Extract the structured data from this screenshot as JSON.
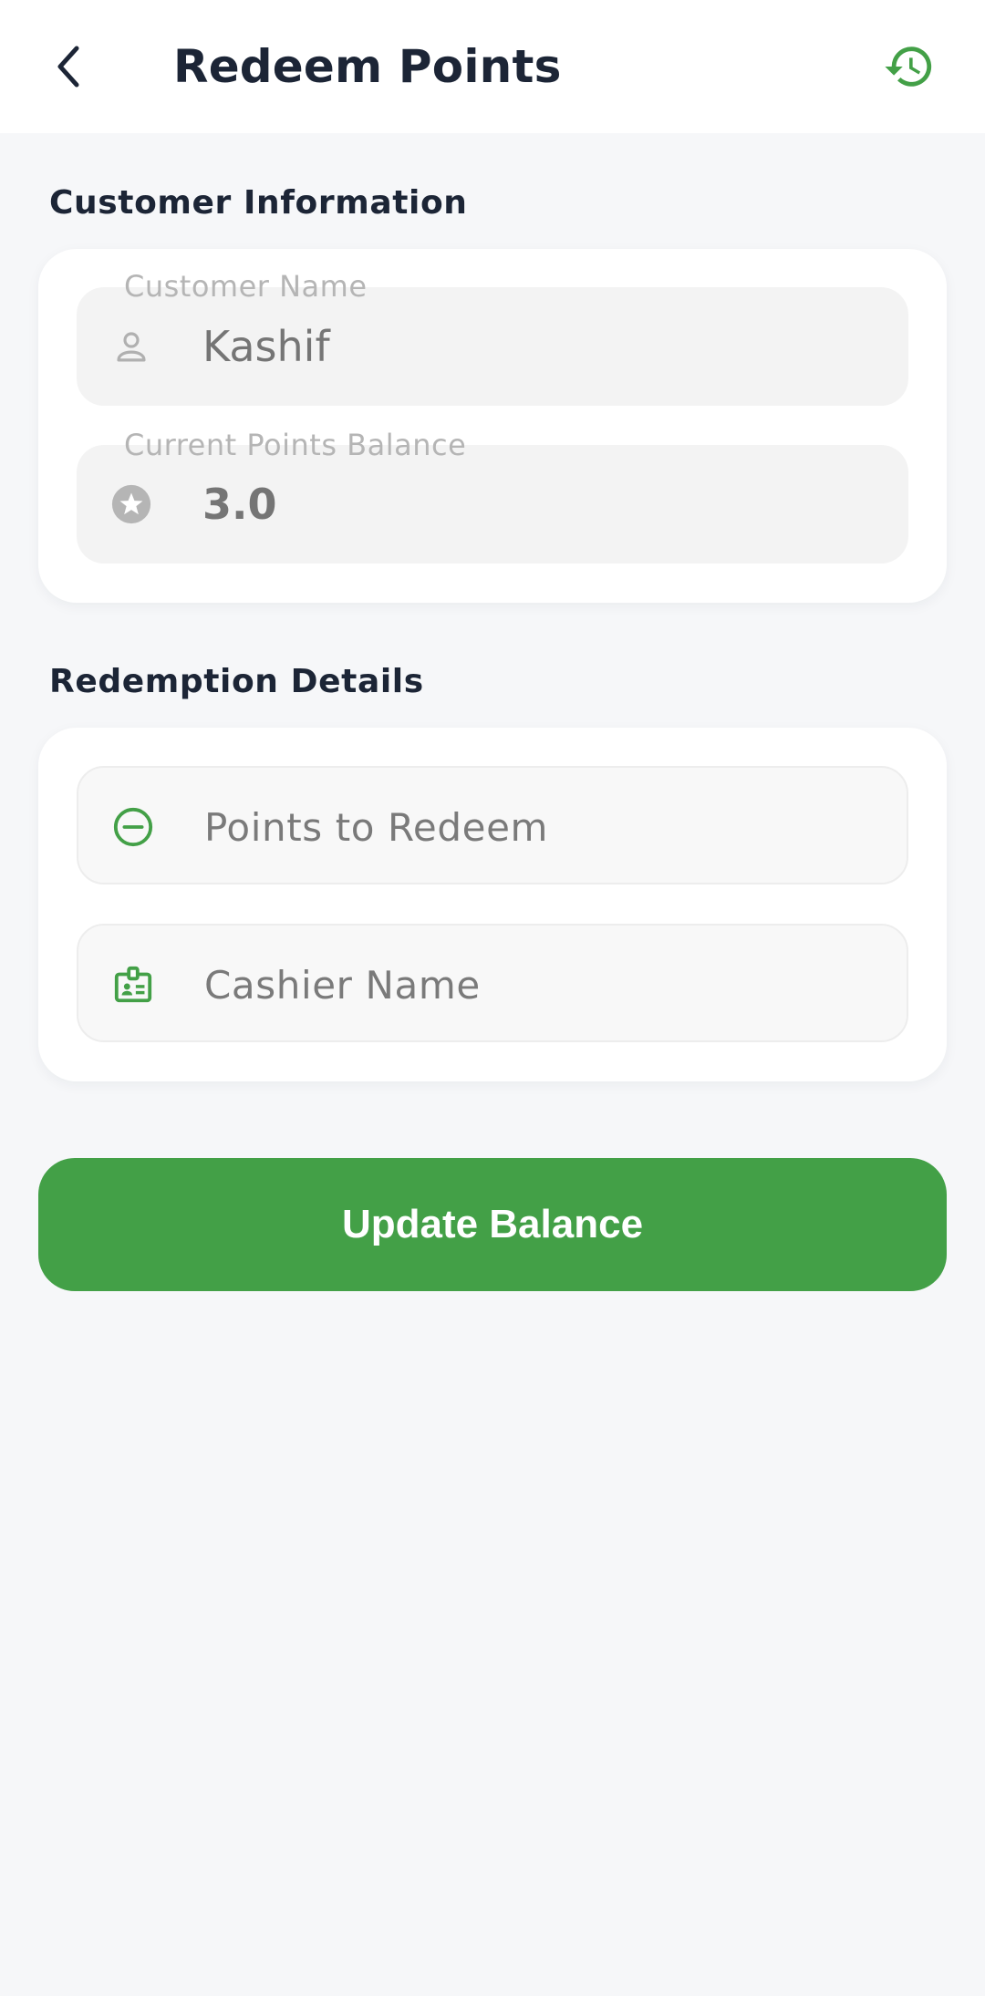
{
  "header": {
    "title": "Redeem Points",
    "back_icon": "chevron-left-icon",
    "history_icon": "history-icon"
  },
  "customer_section": {
    "heading": "Customer Information",
    "customer_name": {
      "label": "Customer Name",
      "value": "Kashif",
      "icon": "person-icon"
    },
    "points_balance": {
      "label": "Current Points Balance",
      "value": "3.0",
      "icon": "star-circle-icon"
    }
  },
  "redemption_section": {
    "heading": "Redemption Details",
    "points_to_redeem": {
      "placeholder": "Points to Redeem",
      "icon": "minus-circle-icon"
    },
    "cashier_name": {
      "placeholder": "Cashier Name",
      "icon": "badge-icon"
    }
  },
  "actions": {
    "update_label": "Update Balance"
  },
  "colors": {
    "accent": "#43a047",
    "title": "#1c2536",
    "background": "#f6f7f9"
  }
}
